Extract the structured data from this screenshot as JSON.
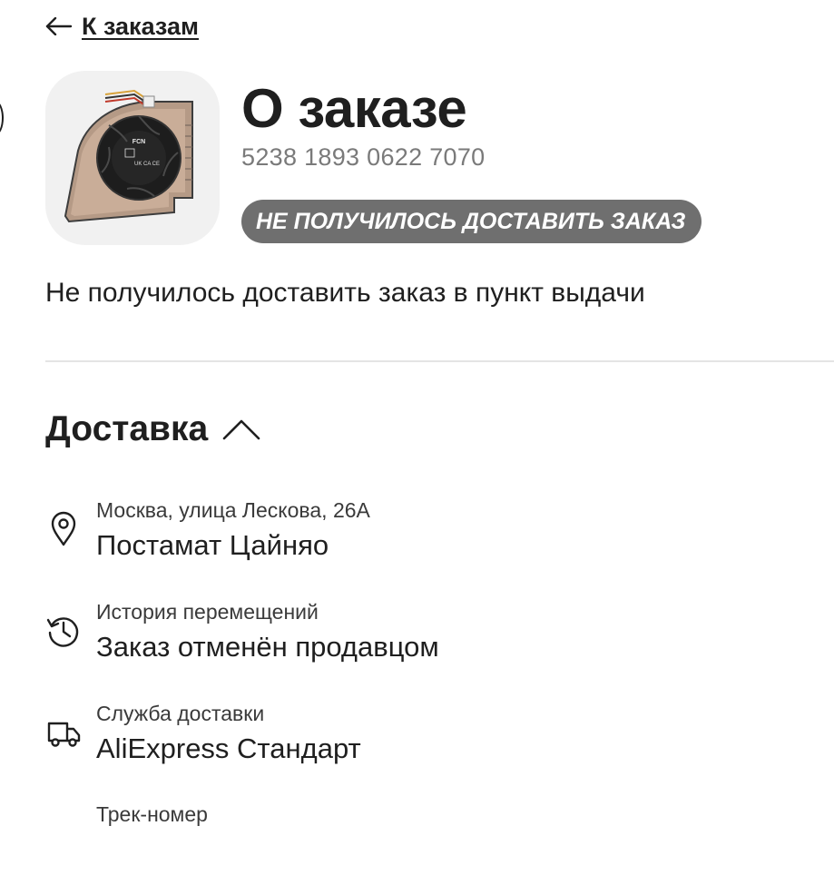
{
  "nav": {
    "back_label": "К заказам"
  },
  "order": {
    "title": "О заказе",
    "number": "5238 1893 0622 7070",
    "status_badge": "НЕ ПОЛУЧИЛОСЬ ДОСТАВИТЬ ЗАКАЗ",
    "status_message": "Не получилось доставить заказ в пункт выдачи"
  },
  "delivery": {
    "section_title": "Доставка",
    "rows": [
      {
        "icon": "location-pin-icon",
        "label": "Москва, улица Лескова, 26А",
        "value": "Постамат Цайняо"
      },
      {
        "icon": "history-icon",
        "label": "История перемещений",
        "value": "Заказ отменён продавцом"
      },
      {
        "icon": "truck-icon",
        "label": "Служба доставки",
        "value": "AliExpress Стандарт"
      },
      {
        "icon": "",
        "label": "Трек-номер"
      }
    ]
  },
  "colors": {
    "badge_bg": "#6f6f6f",
    "divider": "#e4e4e4",
    "text": "#1f1f1f",
    "muted": "#7a7a7a"
  },
  "product_image_text": {
    "brand": "FCN",
    "marks": "UK CA CE"
  }
}
